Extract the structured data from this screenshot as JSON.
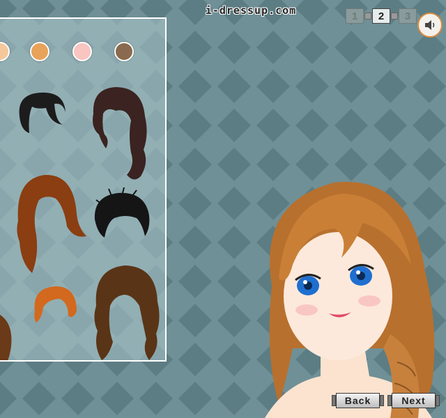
{
  "site": {
    "logo": "i-dressup.com"
  },
  "pager": {
    "pages": [
      "1",
      "2",
      "3"
    ],
    "current": "2"
  },
  "sound": {
    "icon": "speaker-icon"
  },
  "panel": {
    "skin_swatches": [
      {
        "color": "#f4c89a"
      },
      {
        "color": "#e8a25a"
      },
      {
        "color": "#f8c5c0"
      },
      {
        "color": "#8a6a4e"
      }
    ],
    "hairstyles": [
      {
        "color": "#1c1c1c",
        "style": "short"
      },
      {
        "color": "#3a2320",
        "style": "long-wavy"
      },
      {
        "color": "#8a3e12",
        "style": "long-straight"
      },
      {
        "color": "#151515",
        "style": "messy-updo"
      },
      {
        "color": "#d2691e",
        "style": "bob"
      },
      {
        "color": "#5a3416",
        "style": "long-curly"
      }
    ]
  },
  "navigation": {
    "back_label": "Back",
    "next_label": "Next"
  },
  "colors": {
    "background": "#6f9096",
    "diamond": "#5f7f85",
    "panel_border": "#ffffff"
  }
}
